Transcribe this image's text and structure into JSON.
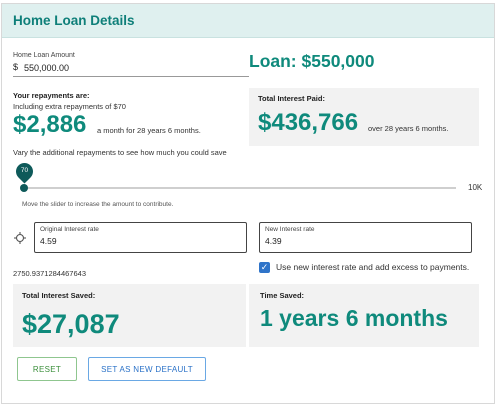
{
  "header": {
    "title": "Home Loan Details"
  },
  "loan_amount": {
    "label": "Home Loan Amount",
    "currency": "$",
    "value": "550,000.00"
  },
  "loan_summary": "Loan: $550,000",
  "repayments": {
    "heading": "Your repayments are:",
    "extra_text": "Including extra repayments of $70",
    "amount": "$2,886",
    "suffix": "a month for 28 years 6 months."
  },
  "total_interest": {
    "label": "Total Interest Paid:",
    "amount": "$436,766",
    "suffix": "over 28 years 6 months."
  },
  "slider": {
    "instruction": "Vary the additional repayments to see how much you could save",
    "value": 70,
    "value_label": "70",
    "min": 0,
    "max_label": "10K",
    "max": 10000,
    "help": "Move the slider to increase the amount to contribute."
  },
  "rates": {
    "original_label": "Original Interest rate",
    "original_value": "4.59",
    "new_label": "New Interest rate",
    "new_value": "4.39"
  },
  "raw_value": "2750.9371284467643",
  "use_new_rate": {
    "checked": true,
    "label": "Use new interest rate and add excess to payments."
  },
  "interest_saved": {
    "label": "Total Interest Saved:",
    "amount": "$27,087"
  },
  "time_saved": {
    "label": "Time Saved:",
    "amount": "1 years 6 months"
  },
  "buttons": {
    "reset": "RESET",
    "default": "SET AS NEW DEFAULT"
  },
  "icons": {
    "rate_target": "crosshair-icon",
    "checkbox_check": "check-icon"
  },
  "colors": {
    "accent": "#0f8a7c",
    "header_bg": "#dff0ef",
    "slider": "#0e5a5a",
    "checkbox": "#2f74c9"
  }
}
